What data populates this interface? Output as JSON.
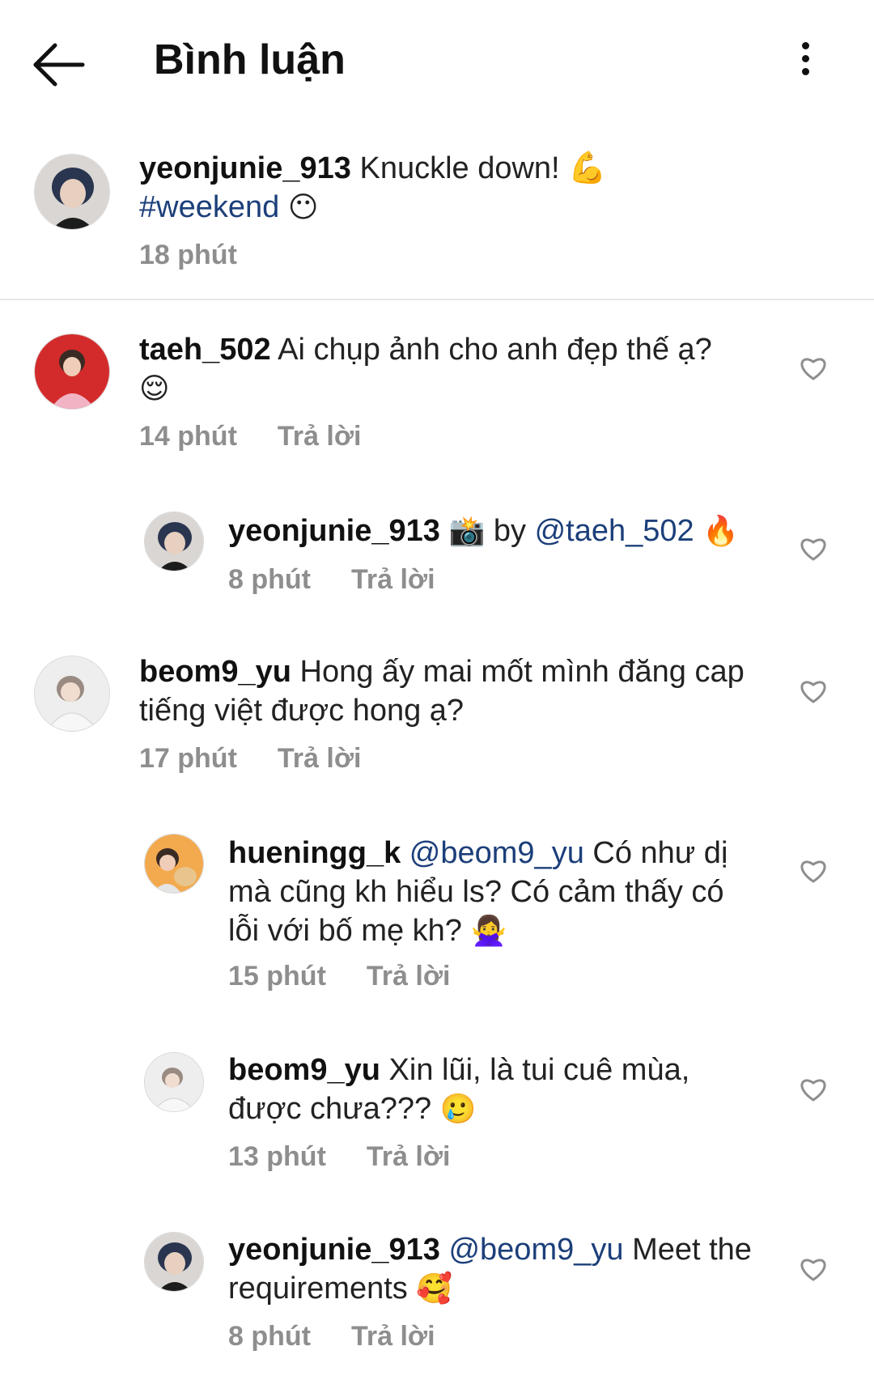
{
  "header": {
    "title": "Bình luận"
  },
  "caption": {
    "username": "yeonjunie_913",
    "text": "Knuckle down! 💪",
    "hashtag": "#weekend",
    "emoji": "😶",
    "time": "18 phút"
  },
  "comments": [
    {
      "username": "taeh_502",
      "text": "Ai chụp ảnh cho anh đẹp thế ạ?",
      "emoji": "😌",
      "time": "14 phút",
      "reply": "Trả lời"
    },
    {
      "username": "yeonjunie_913",
      "camera": "📸",
      "by": "by",
      "mention": "@taeh_502",
      "emoji": "🔥",
      "time": "8 phút",
      "reply": "Trả lời"
    },
    {
      "username": "beom9_yu",
      "text1": "Hong ấy mai mốt mình đăng cap",
      "text2": "tiếng việt được hong ạ?",
      "time": "17 phút",
      "reply": "Trả lời"
    },
    {
      "username": "hueningg_k",
      "mention": "@beom9_yu",
      "text1": "Có như dị",
      "text2": "mà cũng kh hiểu ls? Có cảm thấy có",
      "text3": "lỗi với bố mẹ kh?",
      "emoji": "🙅‍♀️",
      "time": "15 phút",
      "reply": "Trả lời"
    },
    {
      "username": "beom9_yu",
      "text1": "Xin lũi, là tui cuê mùa,",
      "text2": "được chưa???",
      "emoji": "🥲",
      "time": "13 phút",
      "reply": "Trả lời"
    },
    {
      "username": "yeonjunie_913",
      "mention": "@beom9_yu",
      "text1": "Meet the",
      "text2": "requirements",
      "emoji": "🥰",
      "time": "8 phút",
      "reply": "Trả lời"
    }
  ],
  "colors": {
    "link": "#1c3f7a",
    "meta": "#8e8e8e"
  }
}
